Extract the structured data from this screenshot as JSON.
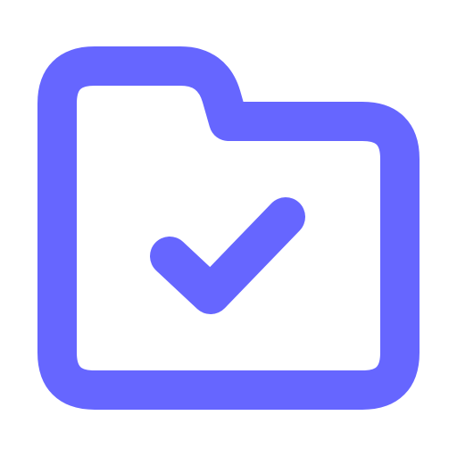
{
  "icon": {
    "name": "folder-check-icon",
    "stroke_color": "#6666FF",
    "background_color": "#FFFFFF"
  }
}
